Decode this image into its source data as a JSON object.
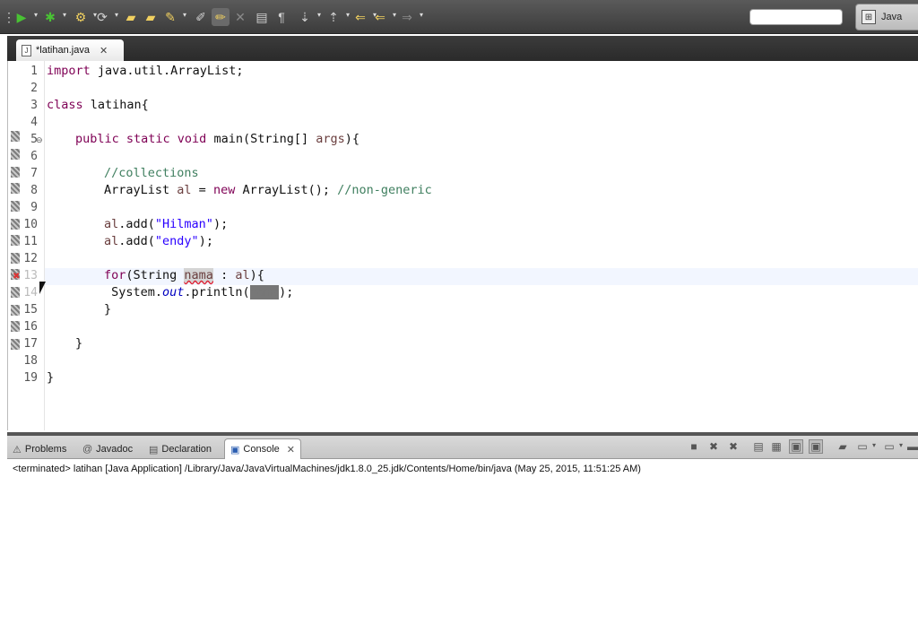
{
  "toolbar": {
    "icons": [
      "run-icon",
      "debug-icon",
      "new-java-project-icon",
      "new-package-icon",
      "open-folder-icon",
      "save-icon",
      "search-icon",
      "toggle-mark-occurrences-icon",
      "highlight-icon",
      "next-annotation-icon",
      "previous-annotation-icon",
      "back-icon",
      "forward-icon"
    ],
    "quick_access_placeholder": "",
    "perspective_label": "Java"
  },
  "editor": {
    "tab_title": "*latihan.java",
    "tab_close": "✕",
    "line_numbers": [
      "1",
      "2",
      "3",
      "4",
      "5",
      "6",
      "7",
      "8",
      "9",
      "10",
      "11",
      "12",
      "13",
      "14",
      "15",
      "16",
      "17",
      "18",
      "19"
    ],
    "lines": {
      "l1_kw": "import",
      "l1_rest": " java.util.ArrayList;",
      "l3_kw": "class",
      "l3_rest": " latihan{",
      "l5_kw": "public static void",
      "l5_rest": " main(String[] ",
      "l5_arg": "args",
      "l5_end": "){",
      "l7_comment": "//collections",
      "l8_type": "ArrayList ",
      "l8_var": "al",
      "l8_mid": " = ",
      "l8_kw": "new",
      "l8_rest": " ArrayList(); ",
      "l8_comment": "//non-generic",
      "l10_var": "al",
      "l10_mid": ".add(",
      "l10_str": "\"Hilman\"",
      "l10_end": ");",
      "l11_var": "al",
      "l11_mid": ".add(",
      "l11_str": "\"endy\"",
      "l11_end": ");",
      "l13_kw": "for",
      "l13_mid": "(String ",
      "l13_var": "nama",
      "l13_sep": " : ",
      "l13_al": "al",
      "l13_end": "){",
      "l14_pre": " System.",
      "l14_out": "out",
      "l14_mid": ".println(",
      "l14_var": "nama",
      "l14_end": ");",
      "l15": "}",
      "l17": "}",
      "l19": "}"
    }
  },
  "console": {
    "tabs": {
      "problems": "Problems",
      "javadoc": "Javadoc",
      "declaration": "Declaration",
      "console": "Console",
      "console_close": "✕"
    },
    "header": "<terminated> latihan [Java Application] /Library/Java/JavaVirtualMachines/jdk1.8.0_25.jdk/Contents/Home/bin/java (May 25, 2015, 11:51:25 AM)"
  },
  "colors": {
    "keyword": "#7f0055",
    "comment": "#3f7f5f",
    "string": "#2a00ff",
    "field": "#0000c0",
    "local_var": "#6a3e3e"
  }
}
